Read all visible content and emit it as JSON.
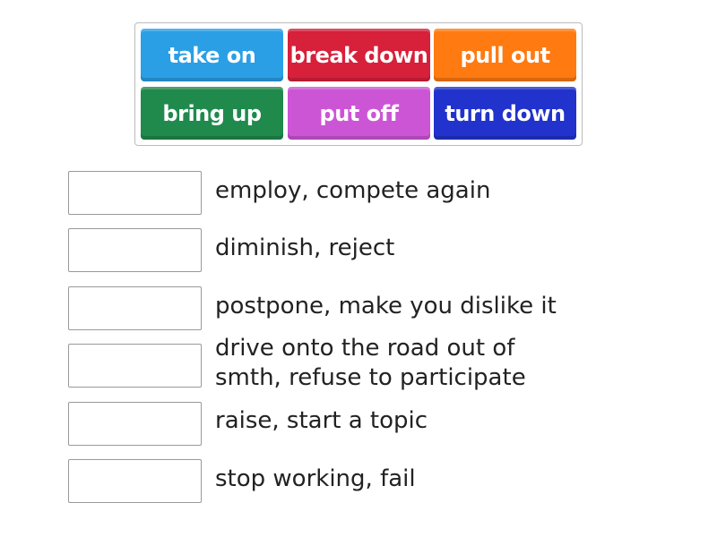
{
  "tiles": [
    {
      "label": "take on",
      "color": "#2a9fe6"
    },
    {
      "label": "break down",
      "color": "#d7203a"
    },
    {
      "label": "pull out",
      "color": "#ff7a10"
    },
    {
      "label": "bring up",
      "color": "#1f8a4c"
    },
    {
      "label": "put off",
      "color": "#cc55d6"
    },
    {
      "label": "turn down",
      "color": "#2133cc"
    }
  ],
  "clues": [
    "employ, compete again",
    "diminish, reject",
    "postpone, make you dislike it",
    "drive onto the road out of smth, refuse to participate",
    "raise, start a topic",
    "stop working, fail"
  ]
}
